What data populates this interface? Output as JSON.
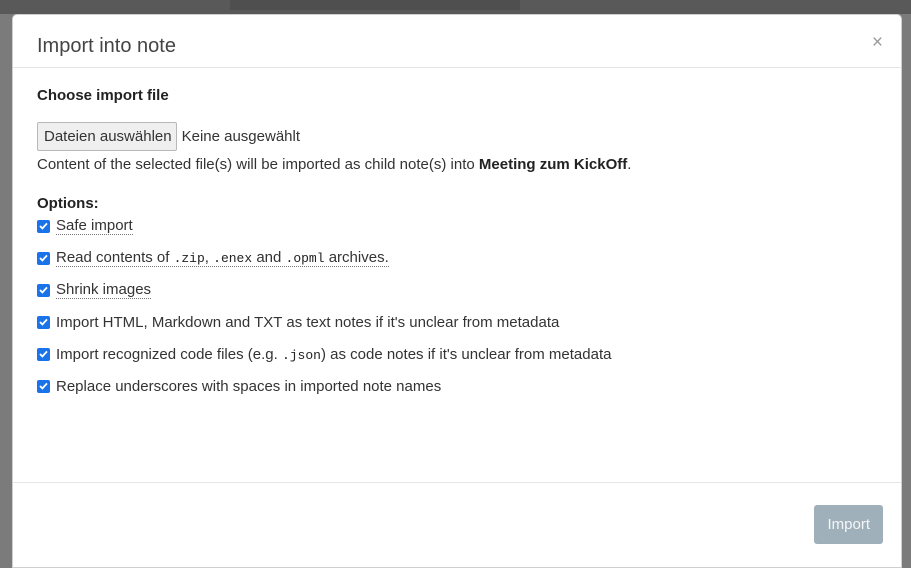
{
  "dialog": {
    "title": "Import into note",
    "close_label": "×"
  },
  "file_section": {
    "title": "Choose import file",
    "button_label": "Dateien auswählen",
    "status_text": "Keine ausgewählt",
    "info_prefix": "Content of the selected file(s) will be imported as child note(s) into ",
    "note_name": "Meeting zum KickOff",
    "info_suffix": "."
  },
  "options": {
    "title": "Options:",
    "safe_import": "Safe import",
    "read_contents": {
      "t1": "Read contents of ",
      "zip": ".zip",
      "t2": ", ",
      "enex": ".enex",
      "t3": " and ",
      "opml": ".opml",
      "t4": " archives."
    },
    "shrink_images": "Shrink images",
    "import_text": "Import HTML, Markdown and TXT as text notes if it's unclear from metadata",
    "import_code": {
      "t1": "Import recognized code files (e.g. ",
      "json": ".json",
      "t2": ") as code notes if it's unclear from metadata"
    },
    "replace_underscores": "Replace underscores with spaces in imported note names"
  },
  "footer": {
    "import_label": "Import"
  },
  "colors": {
    "checkbox": "#1a73e8",
    "import_button_disabled": "#9fb0ba"
  },
  "icons": {
    "close": "close-icon",
    "checkbox": "checkbox-checked-icon"
  }
}
